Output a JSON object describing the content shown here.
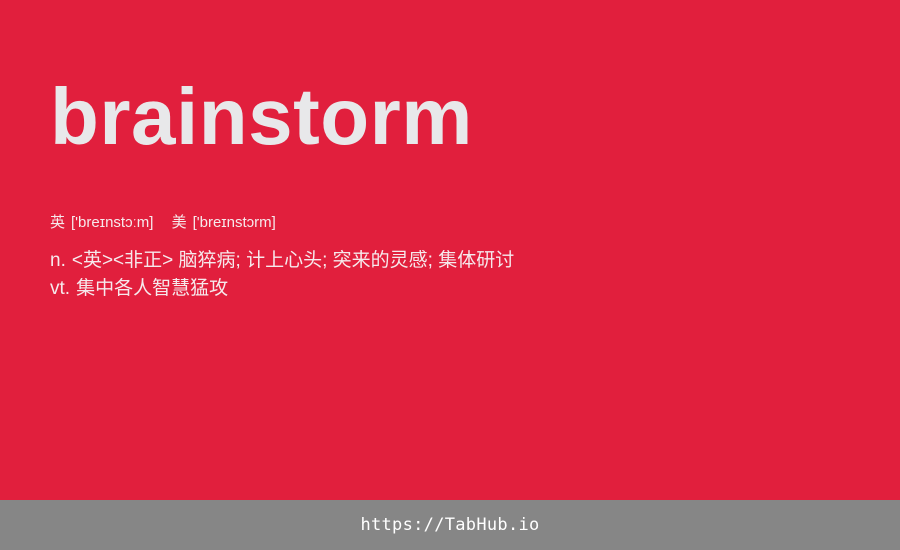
{
  "word": "brainstorm",
  "phonetics": {
    "uk_label": "英",
    "uk": "['breɪnstɔːm]",
    "us_label": "美",
    "us": "['breɪnstɔrm]"
  },
  "definitions": [
    {
      "pos": "n.",
      "text": "<英><非正> 脑猝病; 计上心头; 突来的灵感; 集体研讨"
    },
    {
      "pos": "vt.",
      "text": "集中各人智慧猛攻"
    }
  ],
  "footer": {
    "link_text": "https://TabHub.io"
  },
  "colors": {
    "background": "#E11F3D",
    "footer": "#868686",
    "word": "#E8E8EA"
  }
}
